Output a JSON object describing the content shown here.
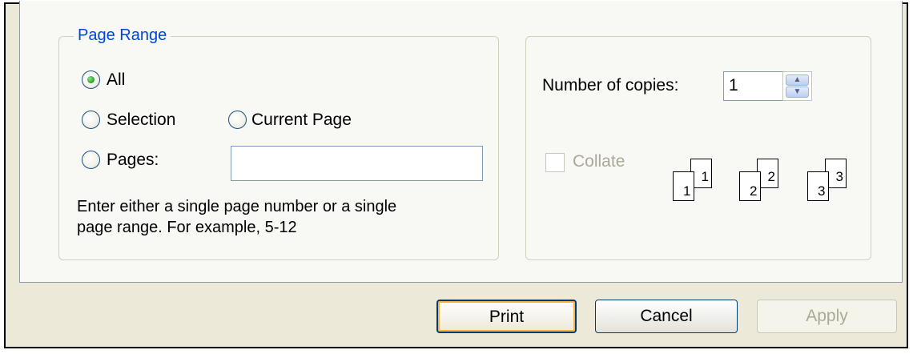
{
  "page_range": {
    "legend": "Page Range",
    "options": {
      "all": "All",
      "selection": "Selection",
      "current_page": "Current Page",
      "pages": "Pages:"
    },
    "selected_option": "All",
    "pages_value": "",
    "help_line1": "Enter either a single page number or a single",
    "help_line2": "page range.  For example, 5-12"
  },
  "copies": {
    "label": "Number of copies:",
    "value": "1",
    "collate_label": "Collate",
    "collate_checked": false,
    "collate_enabled": false,
    "illustration": [
      {
        "front": "1",
        "back": "1"
      },
      {
        "front": "2",
        "back": "2"
      },
      {
        "front": "3",
        "back": "3"
      }
    ]
  },
  "buttons": {
    "print": "Print",
    "cancel": "Cancel",
    "apply": "Apply"
  },
  "colors": {
    "accent": "#0046d5",
    "radio_selected": "#2bb02b",
    "disabled_text": "#aca899",
    "default_button_highlight": "#f8b33f"
  }
}
